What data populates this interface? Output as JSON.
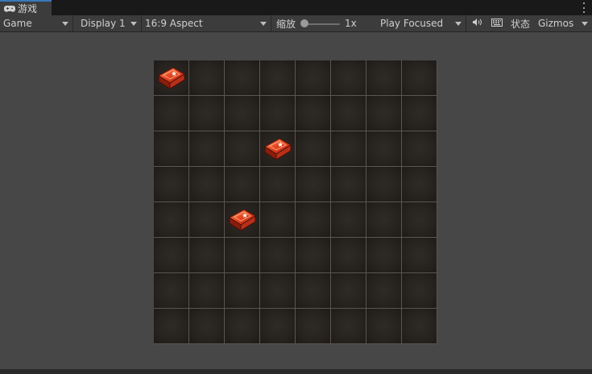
{
  "tab": {
    "title": "游戏",
    "icon": "gamepad-icon"
  },
  "toolbar": {
    "view_mode": "Game",
    "display": "Display 1",
    "aspect": "16:9 Aspect",
    "scale_label": "缩放",
    "scale_value": "1x",
    "play_mode": "Play Focused",
    "audio_icon": "speaker-icon",
    "keyboard_icon": "keyboard-icon",
    "stats_label": "状态",
    "gizmos_label": "Gizmos"
  },
  "board": {
    "rows": 8,
    "cols": 8,
    "pieces": [
      {
        "row": 0,
        "col": 0,
        "type": "red-block"
      },
      {
        "row": 2,
        "col": 3,
        "type": "red-block"
      },
      {
        "row": 4,
        "col": 2,
        "type": "red-block"
      }
    ]
  },
  "colors": {
    "accent": "#3a79bb",
    "piece": "#c0391c",
    "cell": "#27231f"
  }
}
